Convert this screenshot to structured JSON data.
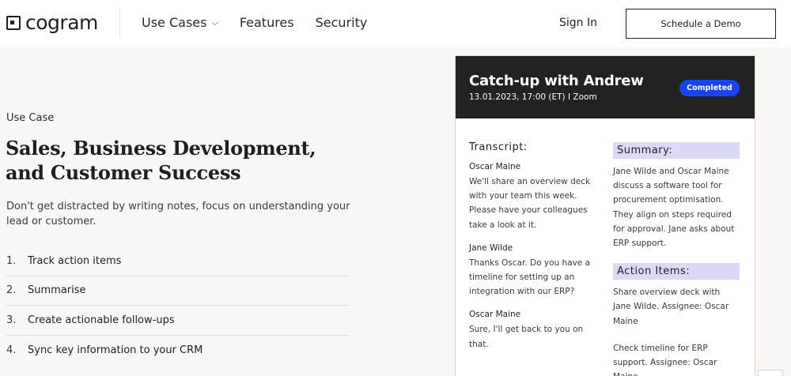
{
  "header": {
    "logo_text": "cogram",
    "nav": [
      {
        "label": "Use Cases",
        "has_dropdown": true
      },
      {
        "label": "Features"
      },
      {
        "label": "Security"
      }
    ],
    "signin_label": "Sign In",
    "demo_label": "Schedule a Demo"
  },
  "left": {
    "eyebrow": "Use Case",
    "headline_line1": "Sales, Business Development,",
    "headline_line2": "and Customer Success",
    "intro": "Don't get distracted by writing notes, focus on understanding your lead or customer.",
    "steps": [
      {
        "num": "1.",
        "label": "Track action items"
      },
      {
        "num": "2.",
        "label": "Summarise"
      },
      {
        "num": "3.",
        "label": "Create actionable follow-ups"
      },
      {
        "num": "4.",
        "label": "Sync key information to your CRM"
      }
    ]
  },
  "card": {
    "title": "Catch-up with Andrew",
    "meta": "13.01.2023, 17:00 (ET) I Zoom",
    "status": "Completed",
    "transcript_title": "Transcript:",
    "transcript": [
      {
        "speaker": "Oscar Maine",
        "text": "We'll share an overview deck with your team this week. Please have your colleagues take a look at it."
      },
      {
        "speaker": "Jane Wilde",
        "text": "Thanks Oscar. Do you have a timeline for setting up an integration with our ERP?"
      },
      {
        "speaker": "Oscar Maine",
        "text": "Sure, I'll get back to you on that."
      }
    ],
    "summary_title": "Summary:",
    "summary": "Jane Wilde and Oscar Maine discuss a software tool for procurement optimisation. They align on steps required for approval. Jane asks about ERP support.",
    "action_items_title": "Action Items:",
    "action_items": [
      "Share overview deck with Jane Wilde. Assignee: Oscar Maine",
      "Check timeline for ERP support. Assignee: Oscar Maine"
    ]
  },
  "colors": {
    "accent_blue": "#1944f1",
    "card_header": "#222222",
    "highlight": "#dcd8f7",
    "page_bg": "#f8f7f5"
  }
}
